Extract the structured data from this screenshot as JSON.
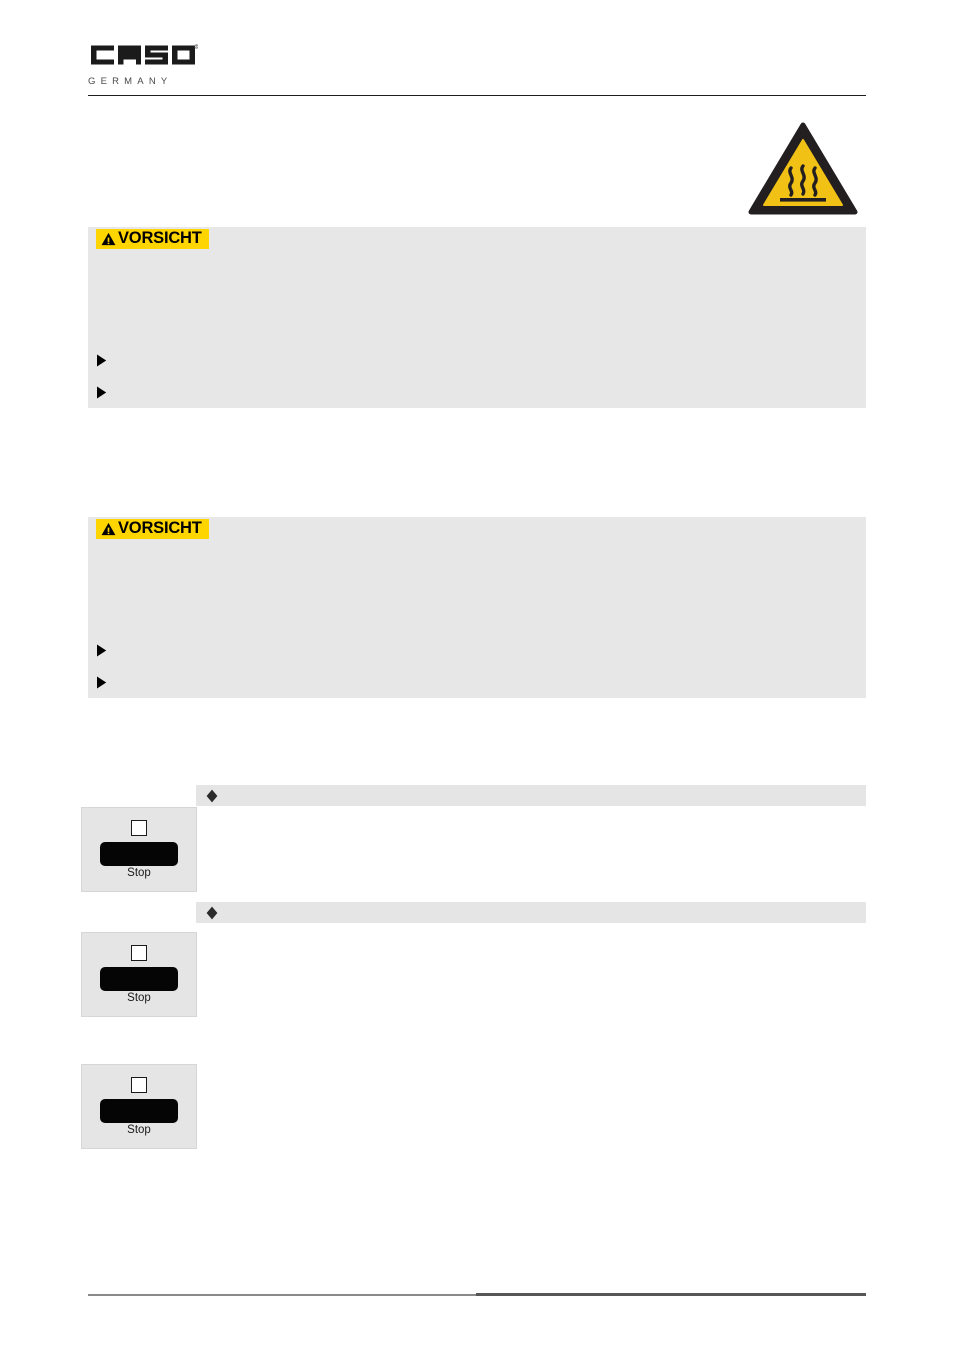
{
  "document": {
    "language": "de",
    "page_background": "#ffffff"
  },
  "header": {
    "brand": "CASO",
    "brand_tagline": "GERMANY",
    "trademark_symbol": "®",
    "rule_color": "#1d1d1d"
  },
  "pictogram": {
    "name": "hot-surface-warning",
    "description": "Warndreieck heiße Oberfläche",
    "triangle_fill": "#f2c115",
    "triangle_border": "#231f20",
    "symbol": "heat-waves-over-bar"
  },
  "warnings": [
    {
      "id": "warning-1",
      "tag_label": "VORSICHT",
      "tag_background": "#ffd500",
      "tag_icon": "warning-triangle-icon",
      "box_background": "#e7e7e7",
      "body": "",
      "bullets": [
        {
          "marker": "triangle-bullet-icon",
          "text": ""
        },
        {
          "marker": "triangle-bullet-icon",
          "text": ""
        }
      ]
    },
    {
      "id": "warning-2",
      "tag_label": "VORSICHT",
      "tag_background": "#ffd500",
      "tag_icon": "warning-triangle-icon",
      "box_background": "#e7e7e7",
      "body": "",
      "bullets": [
        {
          "marker": "triangle-bullet-icon",
          "text": ""
        },
        {
          "marker": "triangle-bullet-icon",
          "text": ""
        }
      ]
    }
  ],
  "body_text": {
    "intro": "",
    "mid": "",
    "lower": "",
    "tail": ""
  },
  "section_bars": [
    {
      "id": "bar-1",
      "marker": "diamond-bullet-icon",
      "heading": "",
      "background": "#e5e5e5"
    },
    {
      "id": "bar-2",
      "marker": "diamond-bullet-icon",
      "heading": "",
      "background": "#e5e5e5"
    }
  ],
  "control_panels": [
    {
      "id": "panel-1",
      "indicator_icon": "square-outline-icon",
      "key_label": "Stop",
      "key_color": "#050505",
      "panel_background": "#e5e5e5",
      "note": ""
    },
    {
      "id": "panel-2",
      "indicator_icon": "square-outline-icon",
      "key_label": "Stop",
      "key_color": "#050505",
      "panel_background": "#e5e5e5",
      "note": ""
    },
    {
      "id": "panel-3",
      "indicator_icon": "square-outline-icon",
      "key_label": "Stop",
      "key_color": "#050505",
      "panel_background": "#e5e5e5",
      "note": ""
    }
  ],
  "footer": {
    "left_text": "",
    "right_text": "",
    "rule_left_color": "#8a8a8a",
    "rule_right_color": "#575757"
  }
}
